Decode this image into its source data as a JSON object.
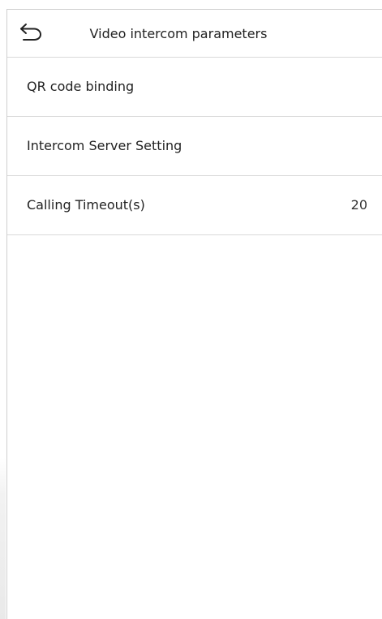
{
  "header": {
    "title": "Video intercom parameters",
    "back_icon": "back-arrow-icon"
  },
  "menu": {
    "items": [
      {
        "label": "QR code binding",
        "value": ""
      },
      {
        "label": "Intercom Server Setting",
        "value": ""
      },
      {
        "label": "Calling Timeout(s)",
        "value": "20"
      }
    ]
  },
  "colors": {
    "background": "#ffffff",
    "divider": "#d9d9d9",
    "text": "#222222"
  }
}
